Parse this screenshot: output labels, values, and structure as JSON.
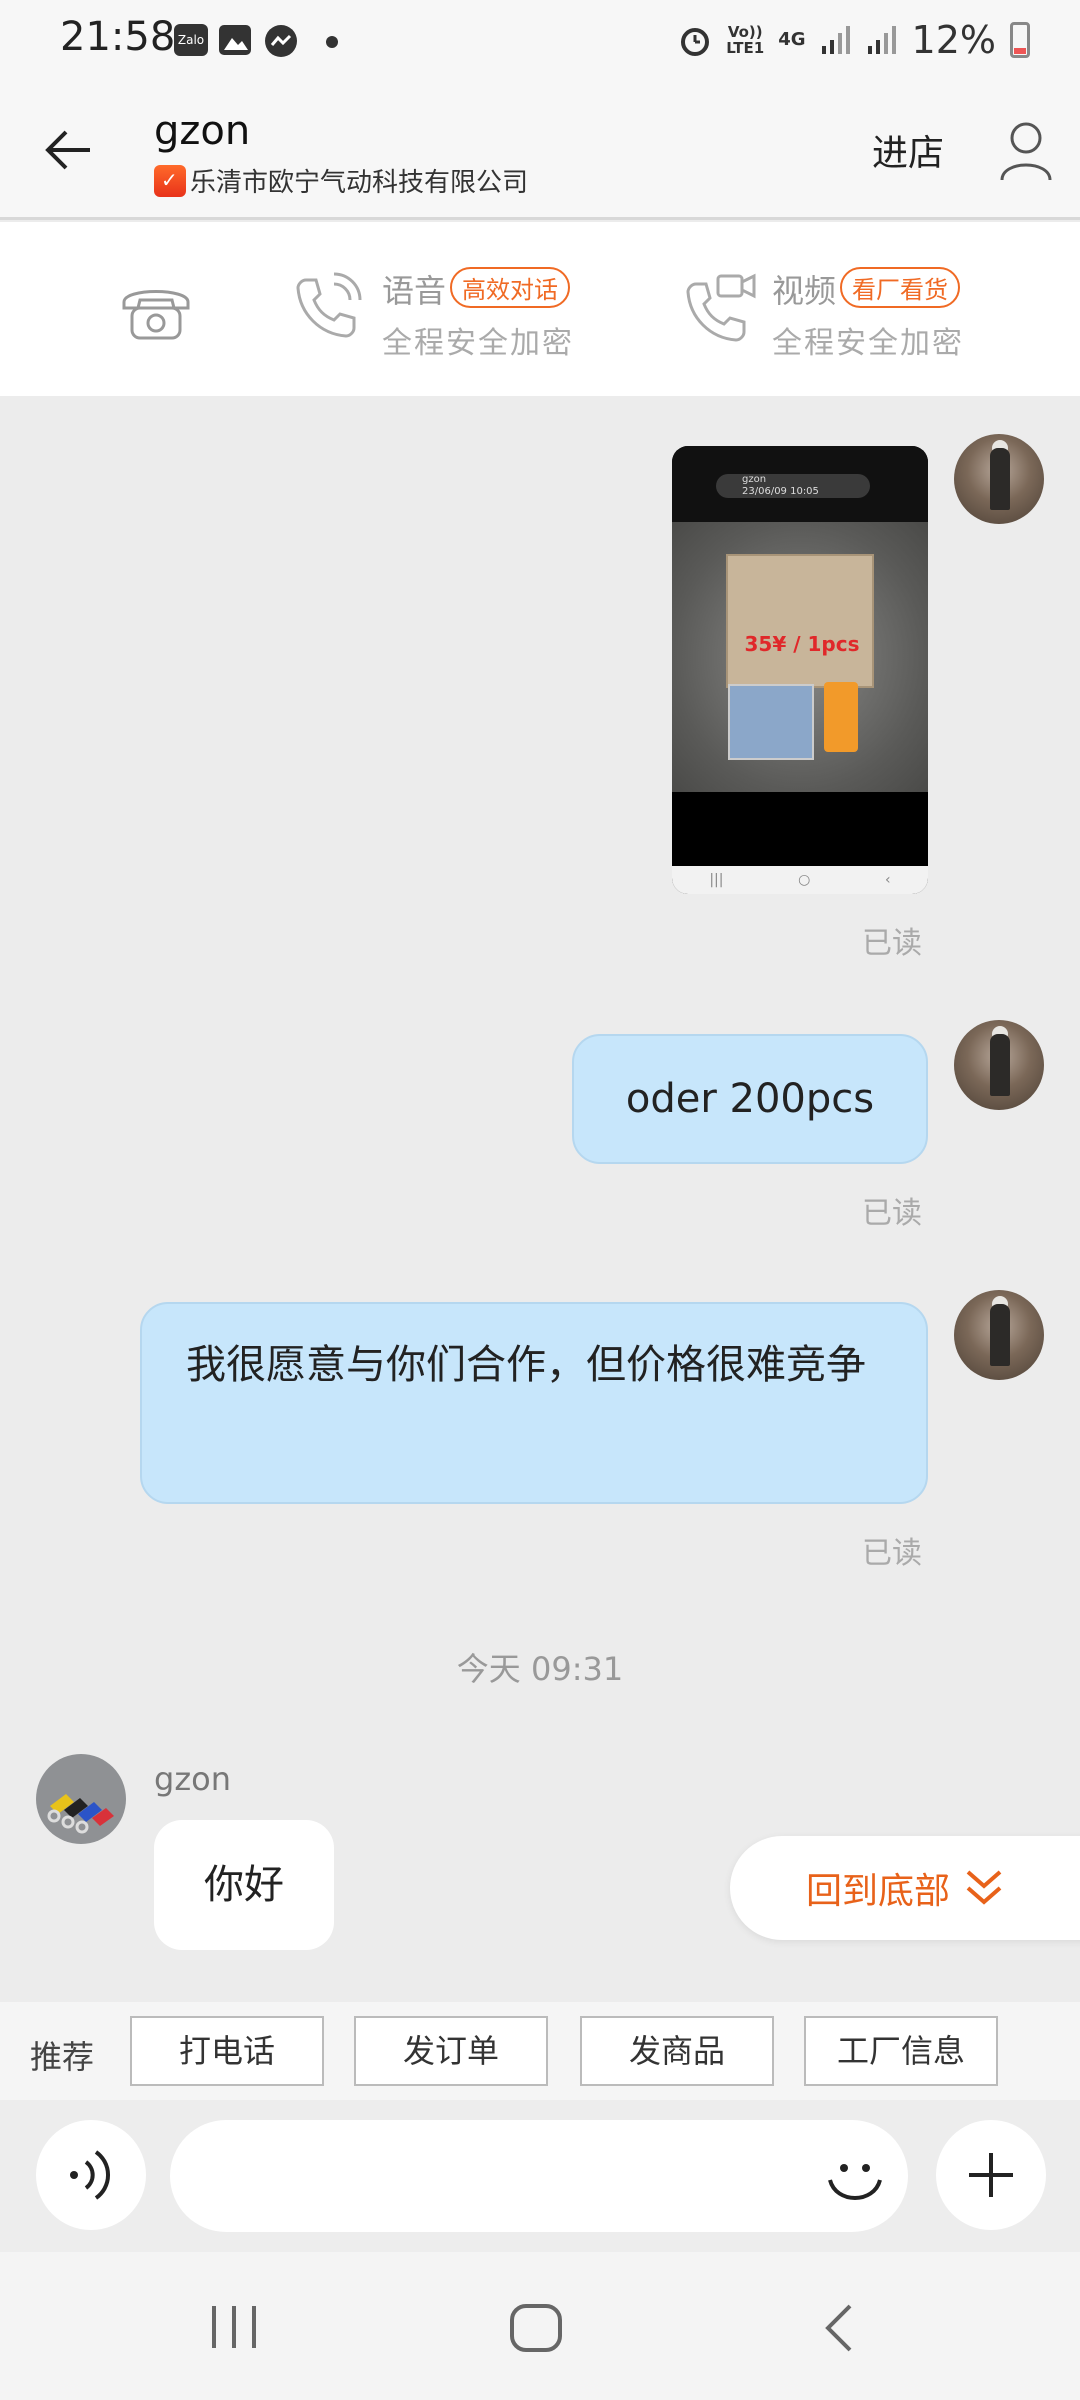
{
  "status_bar": {
    "time": "21:58",
    "apps": [
      "Zalo"
    ],
    "network_top": "Vo))",
    "network_bottom": "LTE1",
    "data_type": "4G",
    "battery": "12%"
  },
  "header": {
    "title": "gzon",
    "company": "乐清市欧宁气动科技有限公司",
    "shop_label": "进店"
  },
  "call_bar": {
    "voice": {
      "label": "语音",
      "badge": "高效对话",
      "sub": "全程安全加密"
    },
    "video": {
      "label": "视频",
      "badge": "看厂看货",
      "sub": "全程安全加密"
    }
  },
  "messages": {
    "image_msg": {
      "chip_title": "gzon",
      "chip_sub": "23/06/09 10:05",
      "price_text": "35¥ / 1pcs",
      "status": "已读"
    },
    "text_msg_1": {
      "text": "oder 200pcs",
      "status": "已读"
    },
    "text_msg_2": {
      "text": "我很愿意与你们合作，但价格很难竞争",
      "status": "已读"
    },
    "time_separator": "今天  09:31",
    "incoming": {
      "sender": "gzon",
      "text": "你好"
    }
  },
  "back_to_bottom": "回到底部",
  "recommend": {
    "label": "推荐",
    "chips": [
      "打电话",
      "发订单",
      "发商品",
      "工厂信息"
    ]
  },
  "input": {
    "placeholder": ""
  },
  "colors": {
    "accent": "#f06a24",
    "bubble_out": "#c7e6fb",
    "background": "#ececec"
  }
}
